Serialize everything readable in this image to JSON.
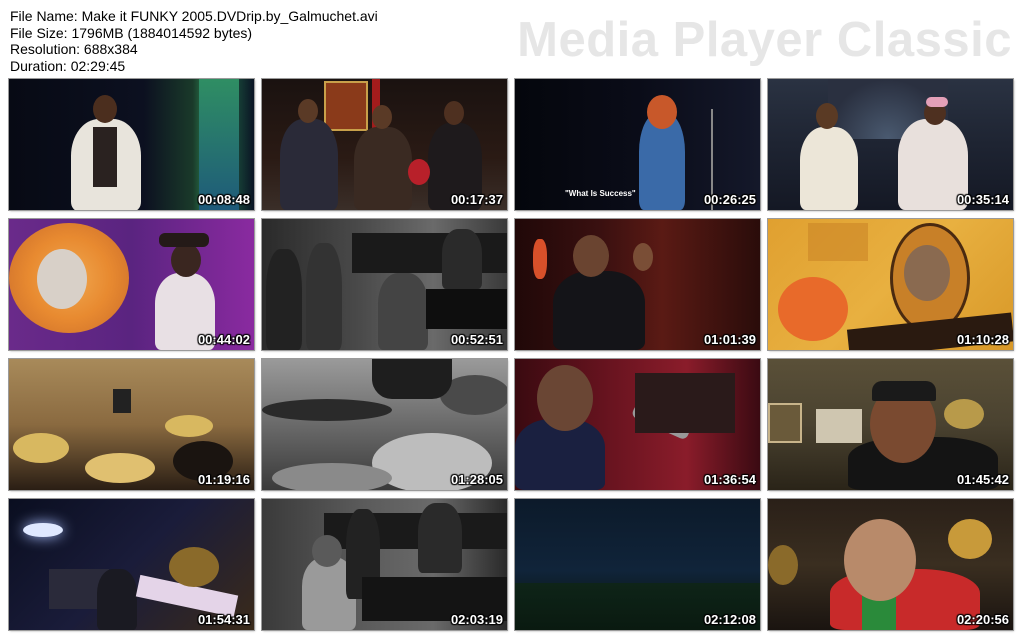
{
  "info": {
    "file_name": "File Name: Make it FUNKY 2005.DVDrip.by_Galmuchet.avi",
    "file_size": "File Size: 1796MB (1884014592 bytes)",
    "resolution": "Resolution: 688x384",
    "duration": "Duration: 02:29:45"
  },
  "brand": "Media Player Classic",
  "thumbnails": [
    {
      "timestamp": "00:08:48"
    },
    {
      "timestamp": "00:17:37"
    },
    {
      "timestamp": "00:26:25",
      "caption": "\"What Is Success\""
    },
    {
      "timestamp": "00:35:14"
    },
    {
      "timestamp": "00:44:02"
    },
    {
      "timestamp": "00:52:51"
    },
    {
      "timestamp": "01:01:39"
    },
    {
      "timestamp": "01:10:28"
    },
    {
      "timestamp": "01:19:16"
    },
    {
      "timestamp": "01:28:05"
    },
    {
      "timestamp": "01:36:54"
    },
    {
      "timestamp": "01:45:42"
    },
    {
      "timestamp": "01:54:31"
    },
    {
      "timestamp": "02:03:19"
    },
    {
      "timestamp": "02:12:08"
    },
    {
      "timestamp": "02:20:56"
    }
  ]
}
